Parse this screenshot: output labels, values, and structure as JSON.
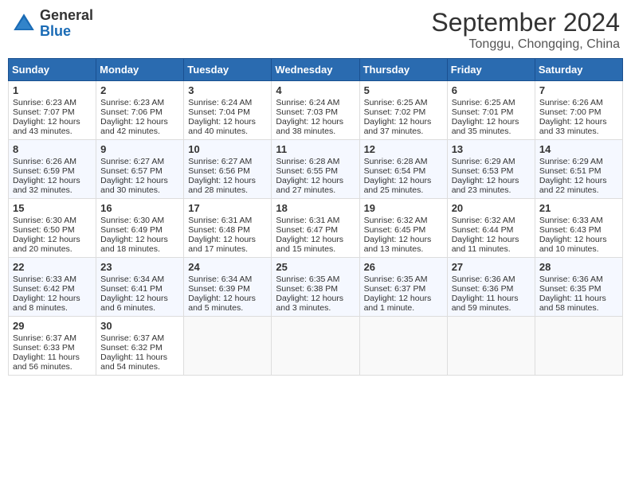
{
  "header": {
    "logo_general": "General",
    "logo_blue": "Blue",
    "title": "September 2024",
    "location": "Tonggu, Chongqing, China"
  },
  "weekdays": [
    "Sunday",
    "Monday",
    "Tuesday",
    "Wednesday",
    "Thursday",
    "Friday",
    "Saturday"
  ],
  "weeks": [
    [
      {
        "day": 1,
        "sunrise": "6:23 AM",
        "sunset": "7:07 PM",
        "daylight": "12 hours and 43 minutes."
      },
      {
        "day": 2,
        "sunrise": "6:23 AM",
        "sunset": "7:06 PM",
        "daylight": "12 hours and 42 minutes."
      },
      {
        "day": 3,
        "sunrise": "6:24 AM",
        "sunset": "7:04 PM",
        "daylight": "12 hours and 40 minutes."
      },
      {
        "day": 4,
        "sunrise": "6:24 AM",
        "sunset": "7:03 PM",
        "daylight": "12 hours and 38 minutes."
      },
      {
        "day": 5,
        "sunrise": "6:25 AM",
        "sunset": "7:02 PM",
        "daylight": "12 hours and 37 minutes."
      },
      {
        "day": 6,
        "sunrise": "6:25 AM",
        "sunset": "7:01 PM",
        "daylight": "12 hours and 35 minutes."
      },
      {
        "day": 7,
        "sunrise": "6:26 AM",
        "sunset": "7:00 PM",
        "daylight": "12 hours and 33 minutes."
      }
    ],
    [
      {
        "day": 8,
        "sunrise": "6:26 AM",
        "sunset": "6:59 PM",
        "daylight": "12 hours and 32 minutes."
      },
      {
        "day": 9,
        "sunrise": "6:27 AM",
        "sunset": "6:57 PM",
        "daylight": "12 hours and 30 minutes."
      },
      {
        "day": 10,
        "sunrise": "6:27 AM",
        "sunset": "6:56 PM",
        "daylight": "12 hours and 28 minutes."
      },
      {
        "day": 11,
        "sunrise": "6:28 AM",
        "sunset": "6:55 PM",
        "daylight": "12 hours and 27 minutes."
      },
      {
        "day": 12,
        "sunrise": "6:28 AM",
        "sunset": "6:54 PM",
        "daylight": "12 hours and 25 minutes."
      },
      {
        "day": 13,
        "sunrise": "6:29 AM",
        "sunset": "6:53 PM",
        "daylight": "12 hours and 23 minutes."
      },
      {
        "day": 14,
        "sunrise": "6:29 AM",
        "sunset": "6:51 PM",
        "daylight": "12 hours and 22 minutes."
      }
    ],
    [
      {
        "day": 15,
        "sunrise": "6:30 AM",
        "sunset": "6:50 PM",
        "daylight": "12 hours and 20 minutes."
      },
      {
        "day": 16,
        "sunrise": "6:30 AM",
        "sunset": "6:49 PM",
        "daylight": "12 hours and 18 minutes."
      },
      {
        "day": 17,
        "sunrise": "6:31 AM",
        "sunset": "6:48 PM",
        "daylight": "12 hours and 17 minutes."
      },
      {
        "day": 18,
        "sunrise": "6:31 AM",
        "sunset": "6:47 PM",
        "daylight": "12 hours and 15 minutes."
      },
      {
        "day": 19,
        "sunrise": "6:32 AM",
        "sunset": "6:45 PM",
        "daylight": "12 hours and 13 minutes."
      },
      {
        "day": 20,
        "sunrise": "6:32 AM",
        "sunset": "6:44 PM",
        "daylight": "12 hours and 11 minutes."
      },
      {
        "day": 21,
        "sunrise": "6:33 AM",
        "sunset": "6:43 PM",
        "daylight": "12 hours and 10 minutes."
      }
    ],
    [
      {
        "day": 22,
        "sunrise": "6:33 AM",
        "sunset": "6:42 PM",
        "daylight": "12 hours and 8 minutes."
      },
      {
        "day": 23,
        "sunrise": "6:34 AM",
        "sunset": "6:41 PM",
        "daylight": "12 hours and 6 minutes."
      },
      {
        "day": 24,
        "sunrise": "6:34 AM",
        "sunset": "6:39 PM",
        "daylight": "12 hours and 5 minutes."
      },
      {
        "day": 25,
        "sunrise": "6:35 AM",
        "sunset": "6:38 PM",
        "daylight": "12 hours and 3 minutes."
      },
      {
        "day": 26,
        "sunrise": "6:35 AM",
        "sunset": "6:37 PM",
        "daylight": "12 hours and 1 minute."
      },
      {
        "day": 27,
        "sunrise": "6:36 AM",
        "sunset": "6:36 PM",
        "daylight": "11 hours and 59 minutes."
      },
      {
        "day": 28,
        "sunrise": "6:36 AM",
        "sunset": "6:35 PM",
        "daylight": "11 hours and 58 minutes."
      }
    ],
    [
      {
        "day": 29,
        "sunrise": "6:37 AM",
        "sunset": "6:33 PM",
        "daylight": "11 hours and 56 minutes."
      },
      {
        "day": 30,
        "sunrise": "6:37 AM",
        "sunset": "6:32 PM",
        "daylight": "11 hours and 54 minutes."
      },
      null,
      null,
      null,
      null,
      null
    ]
  ]
}
